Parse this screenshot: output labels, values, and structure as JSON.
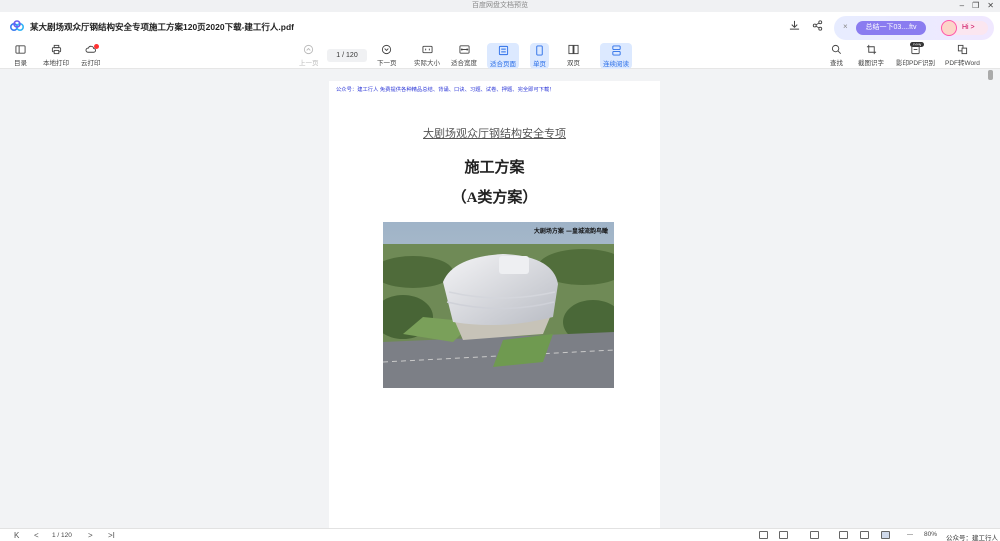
{
  "window": {
    "title": "百度网盘文档预览",
    "controls": [
      "–",
      "❐",
      "✕"
    ]
  },
  "doc": {
    "title": "某大剧场观众厅钢结构安全专项施工方案120页2020下载-建工行人.pdf"
  },
  "chat": {
    "close": "×",
    "summary_label": "总结一下03....ftv",
    "hi_label": "Hi >"
  },
  "toolbar": {
    "left": [
      {
        "label": "目录"
      },
      {
        "label": "本地打印"
      },
      {
        "label": "云打印"
      }
    ],
    "prev_label": "上一页",
    "page_current": "1",
    "page_total": "120",
    "next_label": "下一页",
    "actual_size_label": "实际大小",
    "fit_width_label": "适合宽度",
    "fit_page_label": "适合页面",
    "single_label": "单页",
    "double_label": "双页",
    "continuous_label": "连续阅读",
    "find_label": "查找",
    "screenshot_ocr_label": "截图识字",
    "scan_pdf_label": "影印PDF识别",
    "pdf_word_label": "PDF转Word",
    "new_tag": "new"
  },
  "page": {
    "top_line": "公众号：建工行人 免费提供各种精品总结、背诵、口诀、习题、试卷、押题、完全即可下载！",
    "subtitle": "大剧场观众厅钢结构安全专项",
    "title1": "施工方案",
    "title2": "（A类方案）",
    "photo_caption": "大剧场方案 —皇城流韵鸟瞰"
  },
  "bottombar": {
    "first": "K",
    "prev": "<",
    "page": "1 / 120",
    "next": ">",
    "last": ">I",
    "zoom_out": "—",
    "zoom": "80%",
    "zoom_in": "+",
    "watermark": "公众号：建工行人"
  },
  "colors": {
    "accent": "#2a6ee8",
    "link_blue": "#2f3ad8",
    "chat_purple": "#8a7cf0"
  }
}
